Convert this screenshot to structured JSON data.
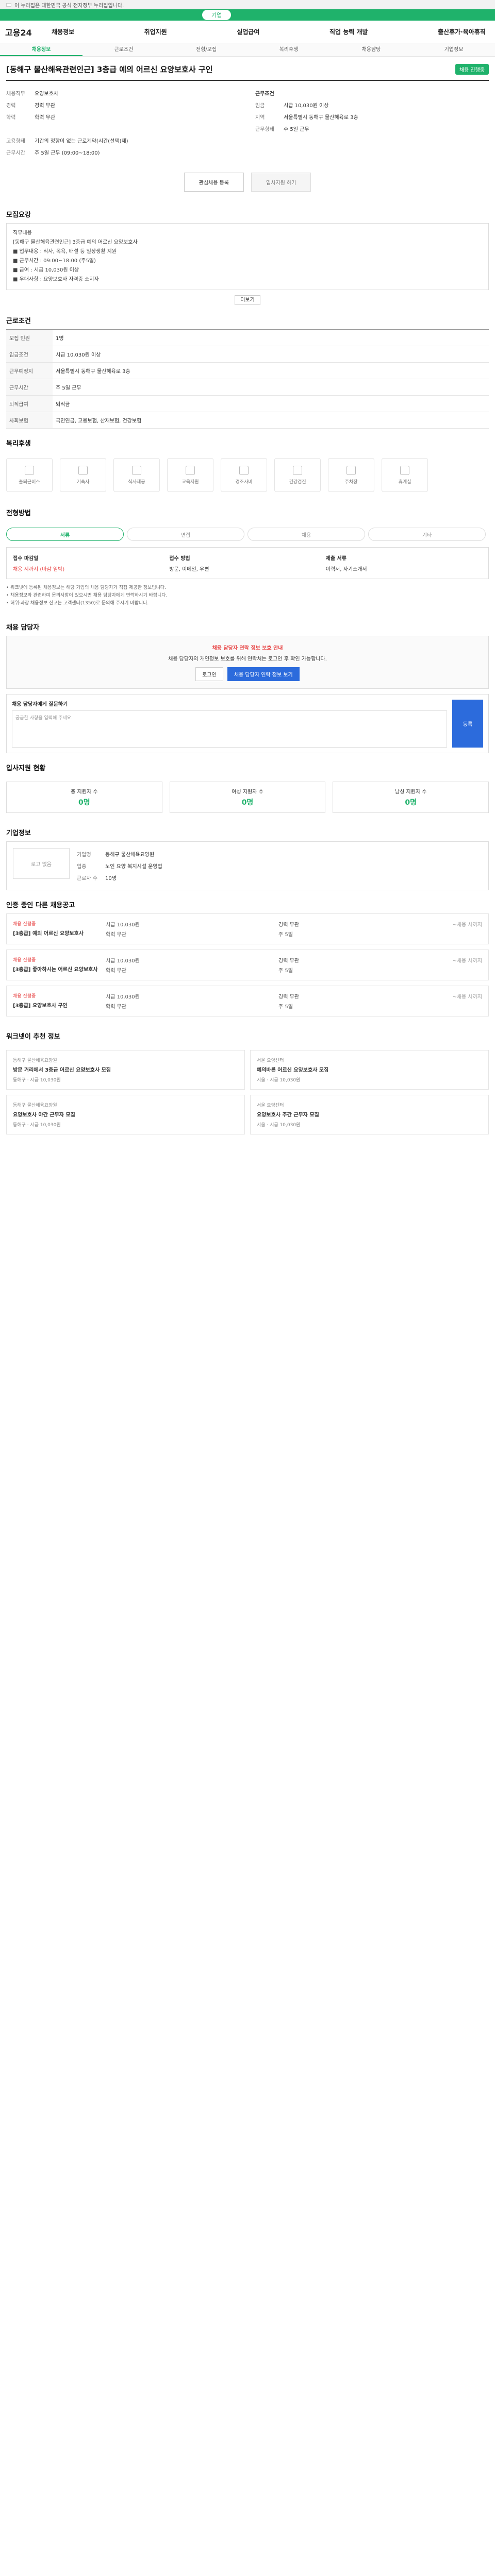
{
  "gov_bar": "이 누리집은 대한민국 공식 전자정부 누리집입니다.",
  "top_pill": "기업",
  "logo": "고용24",
  "gnb": [
    "채용정보",
    "취업지원",
    "실업급여",
    "직업 능력 개발",
    "출산휴가·육아휴직"
  ],
  "tabs": [
    "채용정보",
    "근로조건",
    "전형/모집",
    "복리후생",
    "채용담당",
    "기업정보"
  ],
  "job": {
    "title": "[동해구 물산해육관련인근] 3층급 예의 어르신 요양보호사 구인",
    "badge": "채용 진행중",
    "left_fields": [
      {
        "k": "채용직무",
        "v": "요양보호사"
      },
      {
        "k": "경력",
        "v": "경력 무관"
      },
      {
        "k": "학력",
        "v": "학력 무관"
      }
    ],
    "right_fields": [
      {
        "k": "근무조건",
        "v": ""
      },
      {
        "k": "임금",
        "v": "시급 10,030원 이상"
      },
      {
        "k": "지역",
        "v": "서울특별시 동해구 물산해육로 3층"
      },
      {
        "k": "근무형태",
        "v": "주 5일 근무"
      }
    ],
    "bottom_fields": [
      {
        "k": "고용형태",
        "v": "기간의 정함이 없는 근로계약(시간(선택)제)"
      },
      {
        "k": "근무시간",
        "v": "주 5일 근무 (09:00~18:00)"
      }
    ]
  },
  "actions": {
    "scrap": "관심채용 등록",
    "apply": "입사지원 하기"
  },
  "sections": {
    "detail": "모집요강",
    "work": "근로조건",
    "welfare": "복리후생",
    "process": "전형방법",
    "contact": "채용 담당자",
    "stats": "입사지원 현황",
    "company": "기업정보",
    "others": "인증 중인 다른 채용공고",
    "recommend": "워크넷이 추천 정보"
  },
  "detail_text": [
    "직무내용",
    "[동해구 물산해육관련인근] 3층급 예의 어르신 요양보호사",
    "■ 업무내용 : 식사, 목욕, 배설 등 일상생활 지원",
    "■ 근무시간 : 09:00~18:00 (주5일)",
    "■ 급여 : 시급 10,030원 이상",
    "■ 우대사항 : 요양보호사 자격증 소지자"
  ],
  "more_btn": "더보기",
  "work_rows": [
    {
      "k": "모집 인원",
      "v": "1명"
    },
    {
      "k": "임금조건",
      "v": "시급 10,030원 이상"
    },
    {
      "k": "근무예정지",
      "v": "서울특별시 동해구 물산해육로 3층"
    },
    {
      "k": "근무시간",
      "v": "주 5일 근무"
    },
    {
      "k": "퇴직급여",
      "v": "퇴직금"
    },
    {
      "k": "사회보험",
      "v": "국민연금, 고용보험, 산재보험, 건강보험"
    }
  ],
  "welfare_items": [
    "출퇴근버스",
    "기숙사",
    "식사제공",
    "교육지원",
    "경조사비",
    "건강검진",
    "주차장",
    "휴게실"
  ],
  "process_steps": [
    "서류",
    "면접",
    "채용",
    "기타"
  ],
  "process": {
    "col1_title": "접수 마감일",
    "col1_value": "채용 시까지 (마감 임박)",
    "col2_title": "접수 방법",
    "col2_value": "방문, 이메일, 우편",
    "col3_title": "제출 서류",
    "col3_value": "이력서, 자기소개서"
  },
  "notes": [
    "• 워크넷에 등록된 채용정보는 해당 기업의 채용 담당자가 직접 제공한 정보입니다.",
    "• 채용정보와 관련하여 문의사항이 있으시면 채용 담당자에게 연락하시기 바랍니다.",
    "• 허위·과장 채용정보 신고는 고객센터(1350)로 문의해 주시기 바랍니다."
  ],
  "alert": {
    "title": "채용 담당자 연락 정보 보호 안내",
    "body": "채용 담당자의 개인정보 보호를 위해 연락처는 로그인 후 확인 가능합니다.",
    "btn1": "로그인",
    "btn2": "채용 담당자 연락 정보 보기"
  },
  "question": {
    "label": "채용 담당자에게 질문하기",
    "placeholder": "궁금한 사항을 입력해 주세요.",
    "submit": "등록"
  },
  "stats": [
    {
      "label": "총 지원자 수",
      "value": "0명"
    },
    {
      "label": "여성 지원자 수",
      "value": "0명"
    },
    {
      "label": "남성 지원자 수",
      "value": "0명"
    }
  ],
  "company": {
    "logo": "로고 없음",
    "rows": [
      {
        "k": "기업명",
        "v": "동해구 물산해육요양원"
      },
      {
        "k": "업종",
        "v": "노인 요양 복지시설 운영업"
      },
      {
        "k": "근로자 수",
        "v": "10명"
      }
    ]
  },
  "other_jobs": [
    {
      "co": "채용 진행중",
      "title": "[3층급] 예의 어르신 요양보호사",
      "meta": [
        "시급 10,030원",
        "경력 무관",
        "학력 무관",
        "주 5일"
      ],
      "date": "~채용 시까지"
    },
    {
      "co": "채용 진행중",
      "title": "[3층급] 좋아하시는 어르신 요양보호사",
      "meta": [
        "시급 10,030원",
        "경력 무관",
        "학력 무관",
        "주 5일"
      ],
      "date": "~채용 시까지"
    },
    {
      "co": "채용 진행중",
      "title": "[3층급] 요양보호사 구인",
      "meta": [
        "시급 10,030원",
        "경력 무관",
        "학력 무관",
        "주 5일"
      ],
      "date": "~채용 시까지"
    }
  ],
  "recommend": [
    {
      "co": "동해구 물산해육요양원",
      "title": "방문 거리에서 3층급 어르신 요양보호사 모집",
      "meta": "동해구 · 시급 10,030원"
    },
    {
      "co": "서울 요양센터",
      "title": "예의바른 어르신 요양보호사 모집",
      "meta": "서울 · 시급 10,030원"
    },
    {
      "co": "동해구 물산해육요양원",
      "title": "요양보호사 야간 근무자 모집",
      "meta": "동해구 · 시급 10,030원"
    },
    {
      "co": "서울 요양센터",
      "title": "요양보호사 주간 근무자 모집",
      "meta": "서울 · 시급 10,030원"
    }
  ]
}
